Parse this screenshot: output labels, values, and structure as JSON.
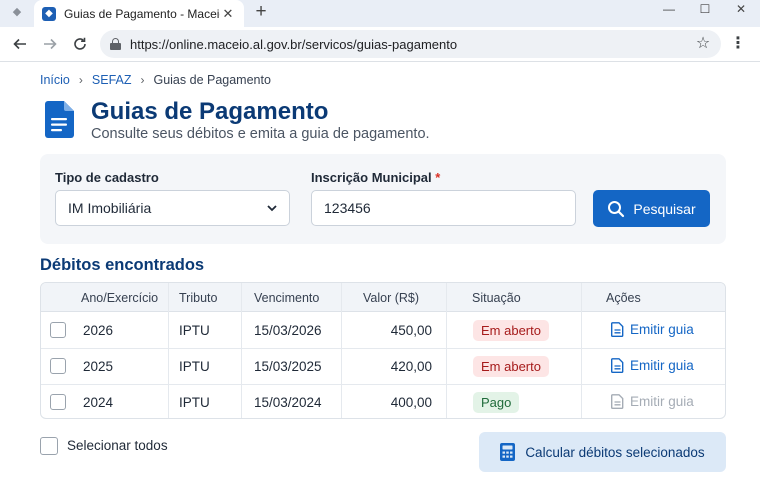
{
  "browser": {
    "tab_title": "Guias de Pagamento - Maceió",
    "url": "https://online.maceio.al.gov.br/servicos/guias-pagamento"
  },
  "breadcrumb": {
    "items": [
      "Início",
      "SEFAZ",
      "Guias de Pagamento"
    ]
  },
  "header": {
    "title": "Guias de Pagamento",
    "subtitle": "Consulte seus débitos e emita a guia de pagamento."
  },
  "filters": {
    "tipo_label": "Tipo de cadastro",
    "tipo_value": "IM Imobiliária",
    "inscricao_label": "Inscrição Municipal",
    "inscricao_required": "*",
    "inscricao_value": "123456",
    "search_button": "Pesquisar"
  },
  "debitos": {
    "title": "Débitos encontrados",
    "columns": [
      "Ano/Exercício",
      "Tributo",
      "Vencimento",
      "Valor (R$)",
      "Situação",
      "Ações"
    ],
    "rows": [
      {
        "ano": "2026",
        "tributo": "IPTU",
        "vencimento": "15/03/2026",
        "valor": "450,00",
        "situacao": "Em aberto",
        "acao": "Emitir guia"
      },
      {
        "ano": "2025",
        "tributo": "IPTU",
        "vencimento": "15/03/2025",
        "valor": "420,00",
        "situacao": "Em aberto",
        "acao": "Emitir guia"
      },
      {
        "ano": "2024",
        "tributo": "IPTU",
        "vencimento": "15/03/2024",
        "valor": "400,00",
        "situacao": "Pago",
        "acao": "Emitir guia"
      }
    ]
  },
  "footer": {
    "select_all": "Selecionar todos",
    "calc_button": "Calcular débitos selecionados"
  },
  "colors": {
    "primary": "#1466c5",
    "title": "#0b3a75",
    "status_open_bg": "#fde5e5",
    "status_paid_bg": "#e3f3e7"
  }
}
